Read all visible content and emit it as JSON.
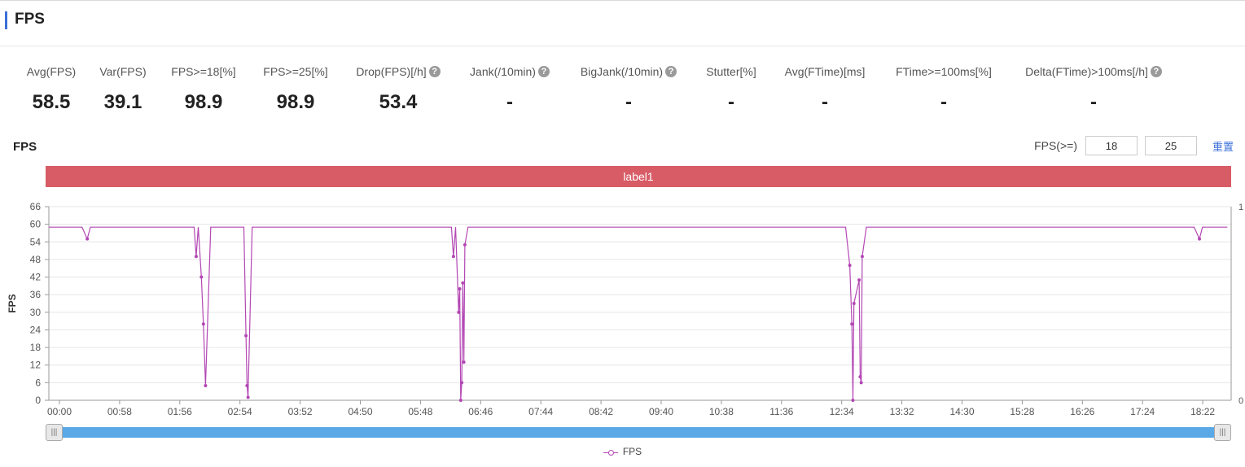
{
  "header": {
    "title": "FPS"
  },
  "metrics": [
    {
      "label": "Avg(FPS)",
      "value": "58.5",
      "help": false
    },
    {
      "label": "Var(FPS)",
      "value": "39.1",
      "help": false
    },
    {
      "label": "FPS>=18[%]",
      "value": "98.9",
      "help": false
    },
    {
      "label": "FPS>=25[%]",
      "value": "98.9",
      "help": false
    },
    {
      "label": "Drop(FPS)[/h]",
      "value": "53.4",
      "help": true
    },
    {
      "label": "Jank(/10min)",
      "value": "-",
      "help": true
    },
    {
      "label": "BigJank(/10min)",
      "value": "-",
      "help": true
    },
    {
      "label": "Stutter[%]",
      "value": "-",
      "help": false
    },
    {
      "label": "Avg(FTime)[ms]",
      "value": "-",
      "help": false
    },
    {
      "label": "FTime>=100ms[%]",
      "value": "-",
      "help": false
    },
    {
      "label": "Delta(FTime)>100ms[/h]",
      "value": "-",
      "help": true
    }
  ],
  "chart_panel": {
    "title": "FPS",
    "filter_label": "FPS(>=)",
    "filter_values": [
      "18",
      "25"
    ],
    "reset_label": "重置",
    "label_bar": "label1"
  },
  "colors": {
    "series": "#b347b4",
    "label_bar": "#d85c66",
    "accent": "#3b6fd8",
    "slider": "#5aa9e6"
  },
  "icons": {
    "help": "question-circle-icon"
  },
  "chart_data": {
    "type": "line",
    "ylabel": "FPS",
    "xlabel": "",
    "ylim": [
      0,
      66
    ],
    "y_ticks": [
      "0",
      "6",
      "12",
      "18",
      "24",
      "30",
      "36",
      "42",
      "48",
      "54",
      "60",
      "66"
    ],
    "y2_ticks": [
      "0",
      "1"
    ],
    "x_ticks": [
      "00:00",
      "00:58",
      "01:56",
      "02:54",
      "03:52",
      "04:50",
      "05:48",
      "06:46",
      "07:44",
      "08:42",
      "09:40",
      "10:38",
      "11:36",
      "12:34",
      "13:32",
      "14:30",
      "15:28",
      "16:26",
      "17:24",
      "18:22"
    ],
    "x_unit_seconds_per_tick": 58,
    "baseline_fps": 59,
    "series": [
      {
        "name": "FPS",
        "drops": [
          {
            "t": "00:37",
            "fps": 55
          },
          {
            "t": "02:22",
            "fps": 49
          },
          {
            "t": "02:27",
            "fps": 42
          },
          {
            "t": "02:29",
            "fps": 26
          },
          {
            "t": "02:31",
            "fps": 5
          },
          {
            "t": "03:10",
            "fps": 22
          },
          {
            "t": "03:11",
            "fps": 5
          },
          {
            "t": "03:12",
            "fps": 1
          },
          {
            "t": "06:30",
            "fps": 49
          },
          {
            "t": "06:35",
            "fps": 30
          },
          {
            "t": "06:36",
            "fps": 38
          },
          {
            "t": "06:37",
            "fps": 0
          },
          {
            "t": "06:38",
            "fps": 6
          },
          {
            "t": "06:39",
            "fps": 40
          },
          {
            "t": "06:40",
            "fps": 13
          },
          {
            "t": "06:41",
            "fps": 53
          },
          {
            "t": "12:52",
            "fps": 46
          },
          {
            "t": "12:54",
            "fps": 26
          },
          {
            "t": "12:55",
            "fps": 0
          },
          {
            "t": "12:56",
            "fps": 33
          },
          {
            "t": "13:01",
            "fps": 41
          },
          {
            "t": "13:02",
            "fps": 8
          },
          {
            "t": "13:03",
            "fps": 6
          },
          {
            "t": "13:04",
            "fps": 49
          },
          {
            "t": "18:29",
            "fps": 55
          }
        ]
      }
    ],
    "legend": [
      "FPS"
    ],
    "legend_position": "bottom-center"
  }
}
